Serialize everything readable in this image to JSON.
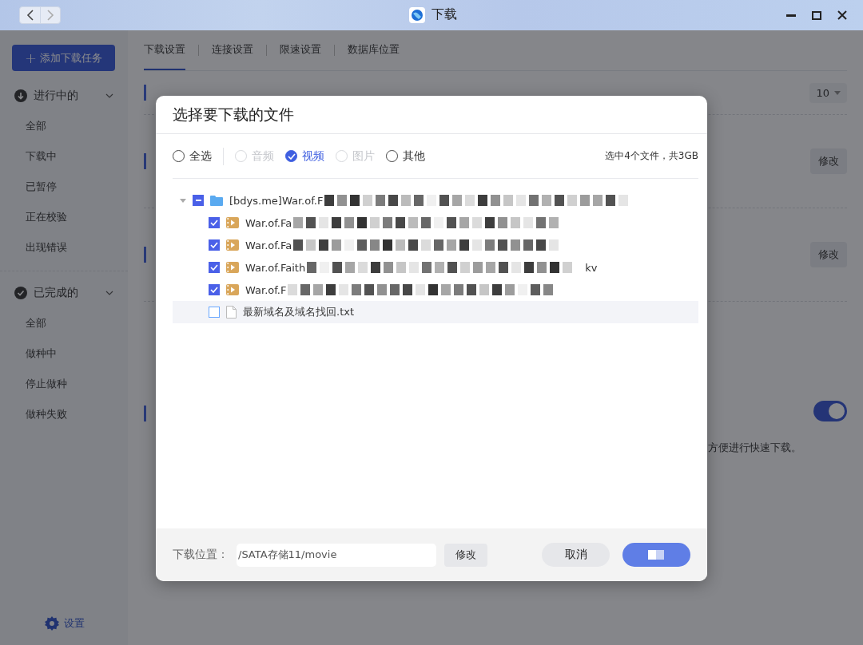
{
  "window": {
    "title": "下载"
  },
  "sidebar": {
    "add_button": {
      "icon": "+",
      "label": "添加下载任务"
    },
    "groups": [
      {
        "kind": "active",
        "label": "进行中的",
        "expanded": true,
        "items": [
          "全部",
          "下载中",
          "已暂停",
          "正在校验",
          "出现错误"
        ]
      },
      {
        "kind": "done",
        "label": "已完成的",
        "expanded": true,
        "items": [
          "全部",
          "做种中",
          "停止做种",
          "做种失败"
        ]
      }
    ],
    "settings_link": "设置"
  },
  "tabs": [
    {
      "label": "下载设置",
      "selected": true
    },
    {
      "label": "连接设置",
      "selected": false
    },
    {
      "label": "限速设置",
      "selected": false
    },
    {
      "label": "数据库位置",
      "selected": false
    }
  ],
  "settings": {
    "concurrent_value": "10",
    "modify_buttons": [
      "修改",
      "修改"
    ],
    "toggle_on": true,
    "description": "方便进行快速下载。"
  },
  "dialog": {
    "title": "选择要下载的文件",
    "filters": [
      {
        "label": "全选",
        "selected": false,
        "disabled": false
      },
      {
        "label": "音频",
        "selected": false,
        "disabled": true
      },
      {
        "label": "视频",
        "selected": true,
        "disabled": false
      },
      {
        "label": "图片",
        "selected": false,
        "disabled": true
      },
      {
        "label": "其他",
        "selected": false,
        "disabled": false
      }
    ],
    "summary": "选中4个文件，共3GB",
    "tree": [
      {
        "kind": "folder",
        "name": "[bdys.me]War.of.F",
        "partial": true,
        "expanded": true,
        "children": [
          {
            "kind": "video",
            "name": "War.of.Fa",
            "checked": true,
            "highlighted": false
          },
          {
            "kind": "video",
            "name": "War.of.Fa",
            "checked": true,
            "highlighted": false
          },
          {
            "kind": "video",
            "name": "War.of.Faith",
            "checked": true,
            "highlighted": false,
            "tail": "kv"
          },
          {
            "kind": "video",
            "name": "War.of.F",
            "checked": true,
            "highlighted": false
          },
          {
            "kind": "text",
            "name": "最新域名及域名找回.txt",
            "checked": false,
            "highlighted": true
          }
        ]
      }
    ],
    "location_label": "下载位置：",
    "location_value": "/SATA存储11/movie",
    "modify_label": "修改",
    "cancel_label": "取消"
  }
}
